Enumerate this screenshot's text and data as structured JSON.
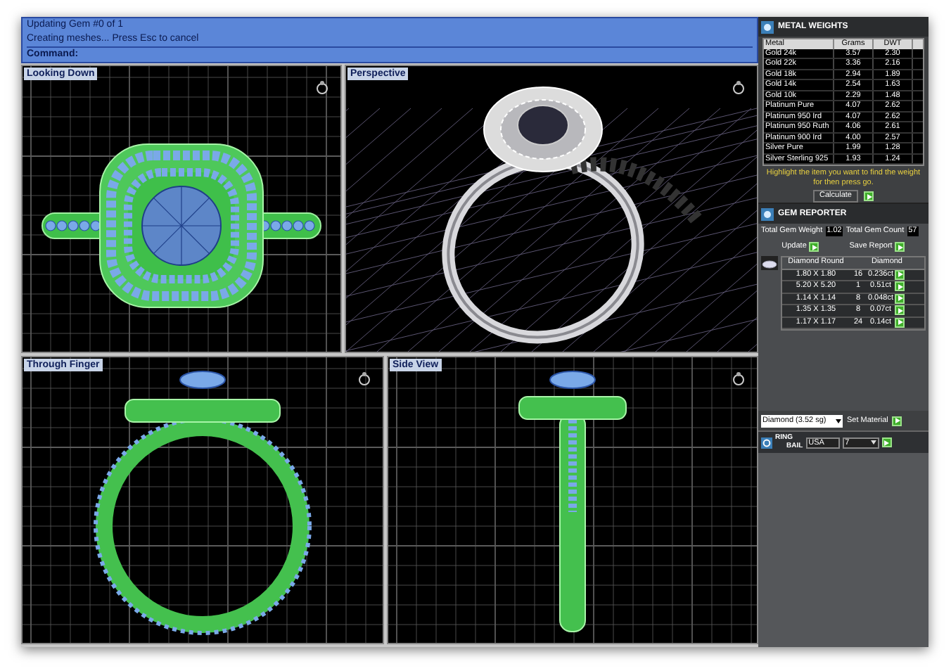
{
  "command_bar": {
    "lines": [
      "Updating Gem #0 of 1",
      "Creating meshes... Press Esc to cancel"
    ],
    "prompt": "Command:"
  },
  "viewports": [
    {
      "label": "Looking Down",
      "kind": "top"
    },
    {
      "label": "Perspective",
      "kind": "perspective"
    },
    {
      "label": "Through Finger",
      "kind": "front"
    },
    {
      "label": "Side View",
      "kind": "side"
    }
  ],
  "metal_weights": {
    "title": "METAL WEIGHTS",
    "columns": [
      "Metal",
      "Grams",
      "DWT"
    ],
    "rows": [
      [
        "Gold 24k",
        "3.57",
        "2.30"
      ],
      [
        "Gold 22k",
        "3.36",
        "2.16"
      ],
      [
        "Gold 18k",
        "2.94",
        "1.89"
      ],
      [
        "Gold 14k",
        "2.54",
        "1.63"
      ],
      [
        "Gold 10k",
        "2.29",
        "1.48"
      ],
      [
        "Platinum Pure",
        "4.07",
        "2.62"
      ],
      [
        "Platinum 950 Ird",
        "4.07",
        "2.62"
      ],
      [
        "Platinum 950 Ruth",
        "4.06",
        "2.61"
      ],
      [
        "Platinum 900 Ird",
        "4.00",
        "2.57"
      ],
      [
        "Silver Pure",
        "1.99",
        "1.28"
      ],
      [
        "Silver Sterling 925",
        "1.93",
        "1.24"
      ]
    ],
    "hint": "Highlight the item you want to find the weight for then press go.",
    "button": "Calculate"
  },
  "gem_reporter": {
    "title": "GEM REPORTER",
    "weight_label": "Total Gem Weight",
    "weight": "1.02",
    "count_label": "Total Gem Count",
    "count": "57",
    "update": "Update",
    "save": "Save Report",
    "columns": [
      "Diamond Round",
      "Diamond"
    ],
    "rows": [
      {
        "size": "1.80 X 1.80",
        "count": "16",
        "weight": "0.236ct"
      },
      {
        "size": "5.20 X 5.20",
        "count": "1",
        "weight": "0.51ct"
      },
      {
        "size": "1.14 X 1.14",
        "count": "8",
        "weight": "0.048ct"
      },
      {
        "size": "1.35 X 1.35",
        "count": "8",
        "weight": "0.07ct"
      },
      {
        "size": "1.17 X 1.17",
        "count": "24",
        "weight": "0.14ct"
      }
    ]
  },
  "material": {
    "value": "Diamond (3.52 sg)",
    "button": "Set Material"
  },
  "ring_size": {
    "title_1": "RING",
    "title_2": "BAIL",
    "standard": "USA",
    "size": "7"
  }
}
